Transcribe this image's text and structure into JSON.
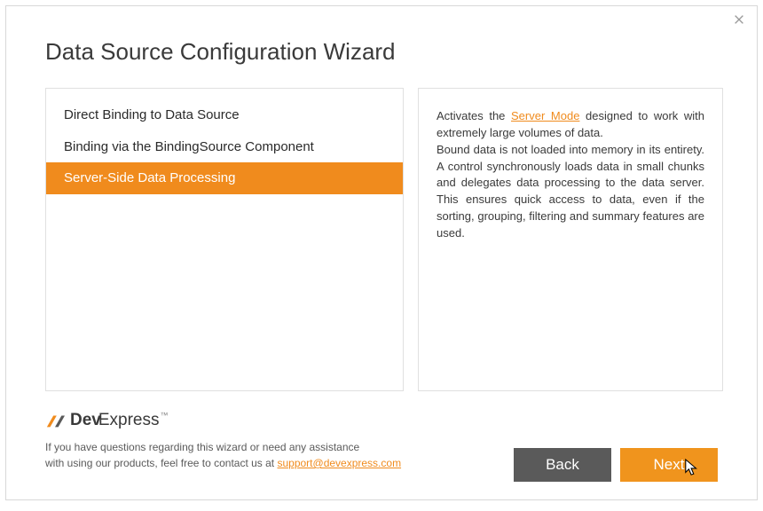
{
  "title": "Data Source Configuration Wizard",
  "options": {
    "item0": "Direct Binding to Data Source",
    "item1": "Binding via the BindingSource Component",
    "item2": "Server-Side Data Processing"
  },
  "desc": {
    "p1a": "Activates the ",
    "p1link": "Server Mode",
    "p1b": " designed to work with extremely large volumes of data.",
    "p2": "Bound data is not loaded into memory in its entirety. A control synchronously loads data in small chunks and delegates data processing to the data server. This ensures quick access to data, even if the sorting, grouping, filtering and summary features are used."
  },
  "logo": {
    "part1": "Dev",
    "part2": "Express",
    "tm": "™"
  },
  "footer": {
    "line1": "If you have questions regarding this wizard or need any assistance",
    "line2a": "with using our products, feel free to contact us at ",
    "email": "support@devexpress.com"
  },
  "buttons": {
    "back": "Back",
    "next": "Next"
  }
}
